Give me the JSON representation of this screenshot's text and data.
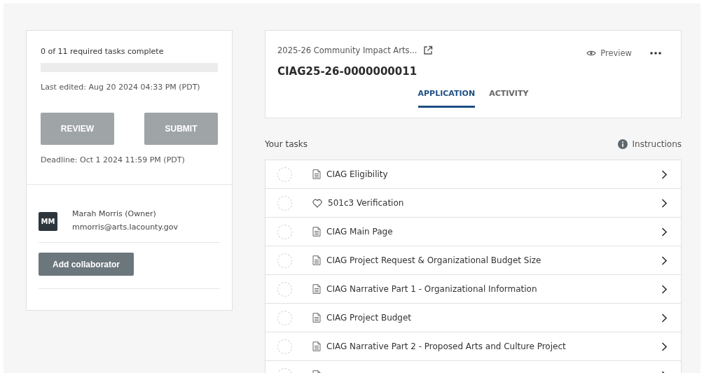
{
  "summary": {
    "progress_text": "0 of 11 required tasks complete",
    "progress": {
      "level": 0
    },
    "last_edited": "Last edited: Aug 20 2024 04:33 PM (PDT)",
    "buttons": [
      {
        "label": "REVIEW",
        "disabled": true
      },
      {
        "label": "SUBMIT",
        "disabled": true
      }
    ],
    "deadline": "Deadline: Oct 1 2024 11:59 PM (PDT)"
  },
  "collaborators": [
    {
      "initials": "MM",
      "name": "Marah Morris (Owner)",
      "email": "mmorris@arts.lacounty.gov"
    }
  ],
  "add_collaborator": "Add collaborator",
  "header": {
    "program": "2025-26 Community Impact Arts...",
    "preview": "Preview",
    "application_id": "CIAG25-26-0000000011",
    "tabs": [
      {
        "label": "APPLICATION",
        "selected": true
      },
      {
        "label": "ACTIVITY",
        "selected": false
      }
    ]
  },
  "tasks_title": "Your tasks",
  "instructions": "Instructions",
  "tasks": [
    {
      "kind": "document",
      "title": "CIAG Eligibility",
      "complete": false
    },
    {
      "kind": "heart",
      "title": "501c3 Verification",
      "complete": false
    },
    {
      "kind": "document",
      "title": "CIAG Main Page",
      "complete": false
    },
    {
      "kind": "document",
      "title": "CIAG Project Request & Organizational Budget Size",
      "complete": false
    },
    {
      "kind": "document",
      "title": "CIAG Narrative Part 1 - Organizational Information",
      "complete": false
    },
    {
      "kind": "document",
      "title": "CIAG Project Budget",
      "complete": false
    },
    {
      "kind": "document",
      "title": "CIAG Narrative Part 2 - Proposed Arts and Culture Project",
      "complete": false
    },
    {
      "kind": "document",
      "complete": false
    }
  ]
}
